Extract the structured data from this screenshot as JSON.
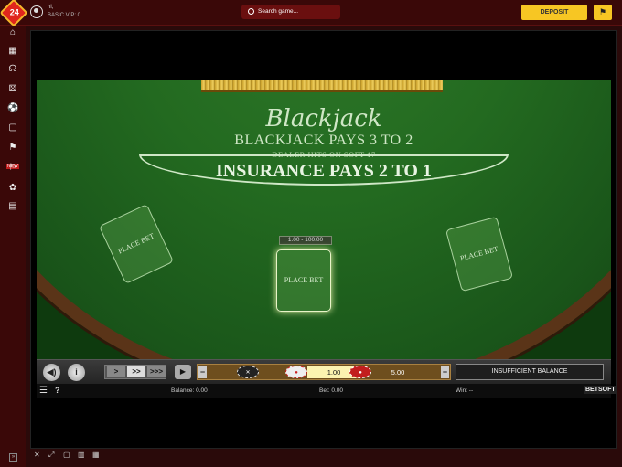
{
  "header": {
    "logo_text": "24",
    "user_name": "hi,",
    "user_level": "BASIC VIP: 0",
    "search_placeholder": "Search game...",
    "deposit_label": "DEPOSIT"
  },
  "sidebar": {
    "items": [
      {
        "icon": "home-icon",
        "glyph": "⌂"
      },
      {
        "icon": "calendar-icon",
        "glyph": "▦"
      },
      {
        "icon": "headset-icon",
        "glyph": "☊"
      },
      {
        "icon": "dice-icon",
        "glyph": "⚄"
      },
      {
        "icon": "soccer-icon",
        "glyph": "⚽"
      },
      {
        "icon": "cards-icon",
        "glyph": "▢"
      },
      {
        "icon": "racing-flags-icon",
        "glyph": "⚑"
      },
      {
        "icon": "gift-icon",
        "glyph": "⚐"
      },
      {
        "icon": "brain-icon",
        "glyph": "✿"
      },
      {
        "icon": "cashier-icon",
        "glyph": "▤"
      }
    ],
    "new_badge": "NEW"
  },
  "game": {
    "title": "Blackjack",
    "pays_text": "BLACKJACK PAYS 3 TO 2",
    "dealer_text": "DEALER HITS ON SOFT 17",
    "insurance_text": "INSURANCE PAYS 2 TO 1",
    "bet_spots": [
      "PLACE BET",
      "PLACE BET",
      "PLACE BET"
    ],
    "bet_limits": "1.00 - 100.00"
  },
  "toolbar": {
    "speed_buttons": [
      ">",
      ">>",
      ">>>"
    ],
    "chip_left_value": "1.00",
    "chip_right_value": "5.00",
    "status": "INSUFFICIENT BALANCE"
  },
  "info": {
    "balance": "Balance: 0.00",
    "bet": "Bet: 0.00",
    "win": "Win: --",
    "brand": "BETSOFT"
  },
  "colors": {
    "accent": "#f7c623",
    "felt": "#236a20",
    "topbar": "#3a0808"
  }
}
